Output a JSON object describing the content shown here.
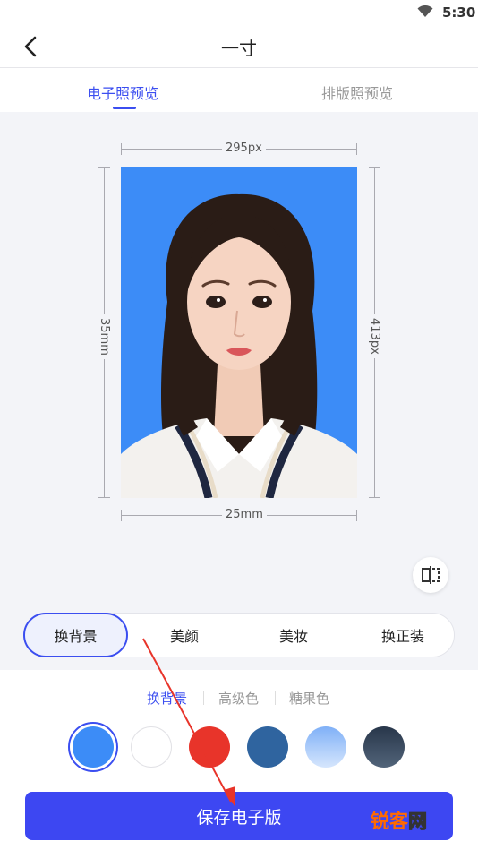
{
  "status_bar": {
    "time": "5:30",
    "wifi_icon": "wifi-icon"
  },
  "header": {
    "title": "一寸",
    "back_icon": "back-arrow-icon"
  },
  "tabs": [
    {
      "label": "电子照预览",
      "active": true
    },
    {
      "label": "排版照预览",
      "active": false
    }
  ],
  "preview": {
    "width_px": "295px",
    "height_px": "413px",
    "width_mm": "25mm",
    "height_mm": "35mm",
    "background_color": "#3c8cf7",
    "compare_icon": "compare-split-icon"
  },
  "edit_options": [
    {
      "label": "换背景",
      "active": true
    },
    {
      "label": "美颜",
      "active": false
    },
    {
      "label": "美妆",
      "active": false
    },
    {
      "label": "换正装",
      "active": false
    }
  ],
  "color_tabs": [
    {
      "label": "换背景",
      "active": true
    },
    {
      "label": "高级色",
      "active": false
    },
    {
      "label": "糖果色",
      "active": false
    }
  ],
  "swatches": [
    {
      "color": "#3c8cf7",
      "selected": true
    },
    {
      "color": "#ffffff",
      "selected": false
    },
    {
      "color": "#e8342a",
      "selected": false
    },
    {
      "color": "#2f649f",
      "selected": false
    },
    {
      "color": "#a9ccfb",
      "selected": false
    },
    {
      "color": "#39485b",
      "selected": false
    }
  ],
  "save_button": {
    "label": "保存电子版"
  },
  "watermark": {
    "part1": "锐客",
    "part2": "网"
  },
  "colors": {
    "accent": "#3b4ef0",
    "save_button": "#3d47f2"
  }
}
